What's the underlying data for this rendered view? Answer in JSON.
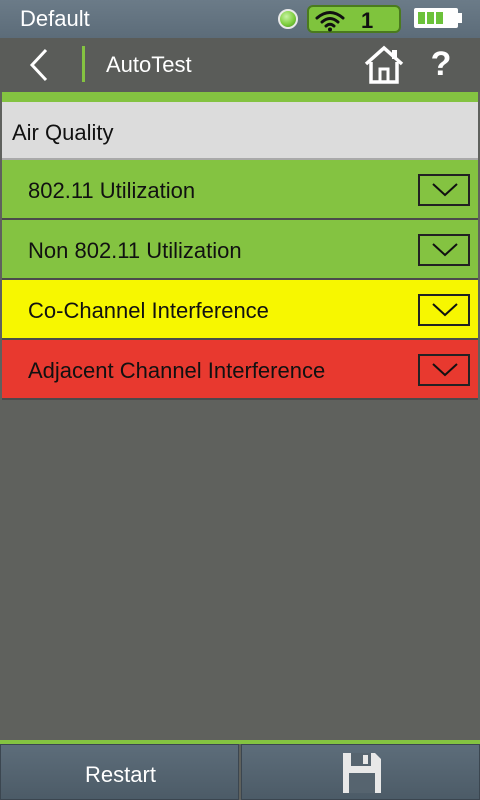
{
  "status_bar": {
    "title": "Default",
    "wifi_count": "1",
    "led_icon": "status-led-icon",
    "wifi_icon": "wifi-icon",
    "battery_icon": "battery-icon",
    "battery_level": 0.8
  },
  "nav": {
    "title": "AutoTest",
    "back_icon": "chevron-left-icon",
    "home_icon": "home-icon",
    "help_label": "?"
  },
  "section": {
    "header": "Air Quality",
    "items": [
      {
        "label": "802.11 Utilization",
        "color": "#84c341"
      },
      {
        "label": "Non 802.11 Utilization",
        "color": "#84c341"
      },
      {
        "label": "Co-Channel Interference",
        "color": "#f7f700"
      },
      {
        "label": "Adjacent Channel Interference",
        "color": "#e8392f"
      }
    ]
  },
  "bottom": {
    "restart_label": "Restart",
    "save_icon": "save-icon"
  },
  "colors": {
    "accent_green": "#84c341",
    "background": "#5f615d"
  }
}
